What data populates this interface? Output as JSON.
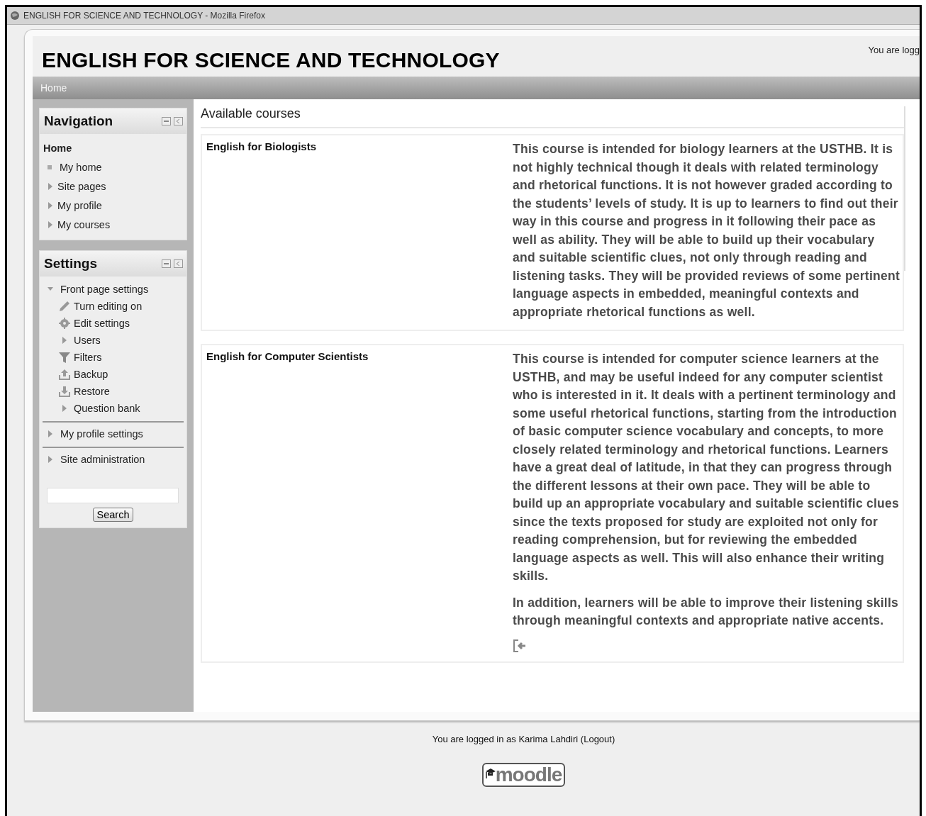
{
  "window": {
    "title": "ENGLISH FOR SCIENCE AND TECHNOLOGY - Mozilla Firefox"
  },
  "header": {
    "site_title": "ENGLISH FOR SCIENCE AND TECHNOLOGY",
    "login_info": "You are logg"
  },
  "navbar": {
    "items": [
      "Home"
    ]
  },
  "navigation_block": {
    "title": "Navigation",
    "items": [
      {
        "kind": "heading",
        "label": "Home"
      },
      {
        "kind": "leaf",
        "label": "My home"
      },
      {
        "kind": "branch",
        "label": "Site pages",
        "expanded": false
      },
      {
        "kind": "branch",
        "label": "My profile",
        "expanded": false
      },
      {
        "kind": "branch",
        "label": "My courses",
        "expanded": false
      }
    ]
  },
  "settings_block": {
    "title": "Settings",
    "groups": [
      {
        "label": "Front page settings",
        "expanded": true,
        "children": [
          {
            "kind": "pencil",
            "label": "Turn editing on"
          },
          {
            "kind": "gear",
            "label": "Edit settings"
          },
          {
            "kind": "branch",
            "label": "Users",
            "expanded": false
          },
          {
            "kind": "filter",
            "label": "Filters"
          },
          {
            "kind": "upload",
            "label": "Backup"
          },
          {
            "kind": "download",
            "label": "Restore"
          },
          {
            "kind": "branch",
            "label": "Question bank",
            "expanded": false
          }
        ]
      },
      {
        "label": "My profile settings",
        "expanded": false
      },
      {
        "label": "Site administration",
        "expanded": false
      }
    ],
    "search_button": "Search"
  },
  "main": {
    "heading": "Available courses",
    "courses": [
      {
        "name": "English for Biologists",
        "description": [
          "This course is intended for biology learners at the USTHB. It is not highly technical though it deals with related terminology and rhetorical functions. It is not however graded according to the students’ levels of study. It is up to learners to find out their way in this course and progress in it following their pace as well as ability. They will be able to build up their vocabulary and suitable scientific clues, not only through reading and listening tasks. They will be provided reviews of some pertinent language aspects in embedded, meaningful contexts and appropriate rhetorical functions as well."
        ],
        "enrol_icon": false
      },
      {
        "name": "English for Computer Scientists",
        "description": [
          "This course is intended for computer science learners at the USTHB, and may be useful indeed for any computer scientist who is interested in it. It deals with a pertinent terminology and some useful rhetorical functions, starting from the introduction of basic computer science vocabulary and concepts, to more closely related terminology and rhetorical functions. Learners have a great deal of latitude, in that they can progress through the different lessons at their own pace. They will be able to build up an appropriate vocabulary and suitable scientific clues since the texts proposed for study are exploited not only for reading comprehension, but for reviewing the embedded language aspects as well. This will also enhance their writing skills.",
          "In addition, learners will be able to improve their listening skills through meaningful contexts and appropriate native accents."
        ],
        "enrol_icon": true
      }
    ]
  },
  "footer": {
    "login_text": "You are logged in as Karima Lahdiri",
    "logout_link": "(Logout)",
    "logo": "moodle"
  }
}
